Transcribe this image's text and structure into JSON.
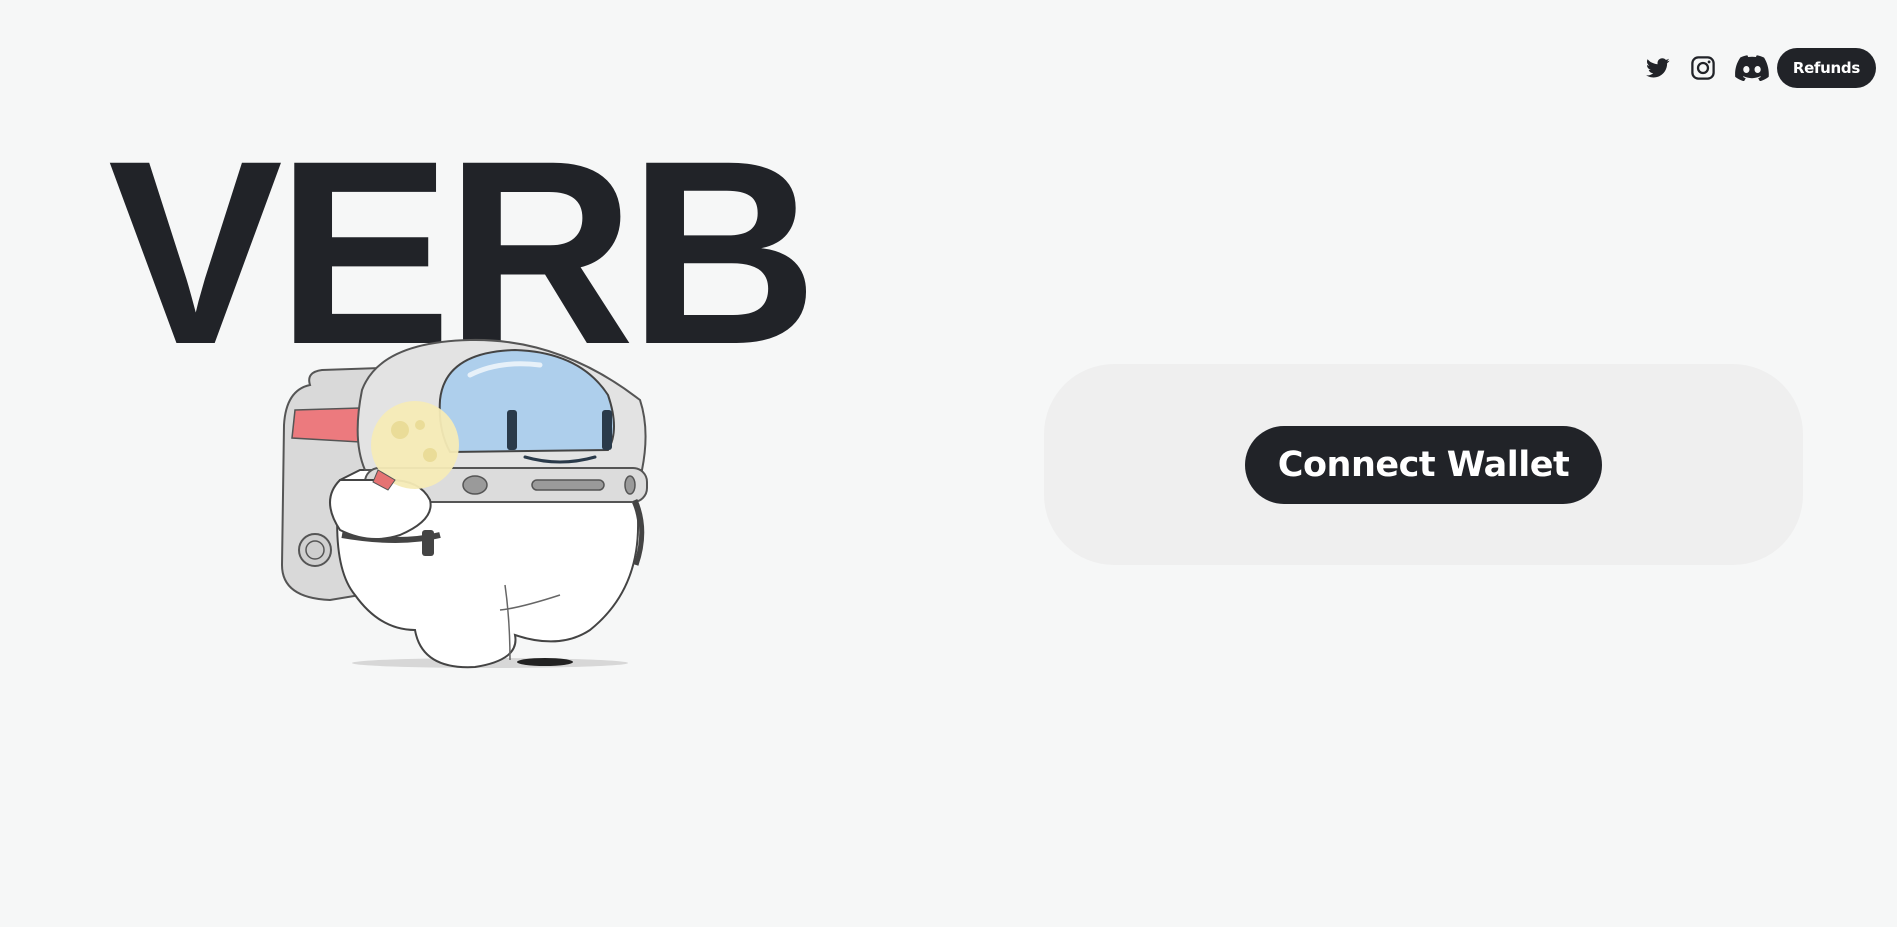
{
  "header": {
    "social": [
      {
        "icon": "twitter-icon"
      },
      {
        "icon": "instagram-icon"
      },
      {
        "icon": "discord-icon"
      }
    ],
    "refunds_label": "Refunds"
  },
  "hero": {
    "title": "VERB",
    "mascot": "astronaut-mascot-illustration"
  },
  "wallet": {
    "connect_label": "Connect Wallet"
  },
  "colors": {
    "background": "#f6f7f7",
    "dark": "#212328",
    "card": "#efefef",
    "visor": "#aecfec",
    "moon": "#f6ebb6",
    "strap": "#ec7a7e"
  }
}
